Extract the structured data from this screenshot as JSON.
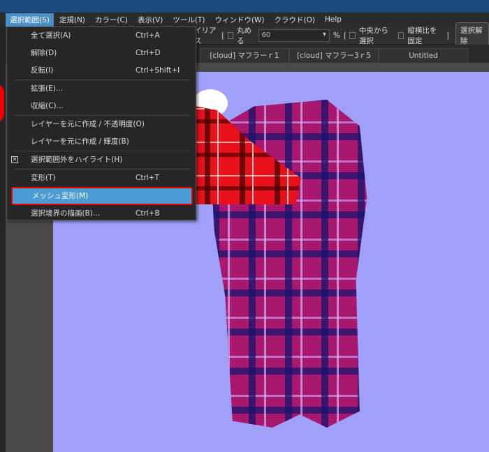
{
  "menubar": [
    "選択範囲(S)",
    "定規(N)",
    "カラー(C)",
    "表示(V)",
    "ツール(T)",
    "ウィンドウ(W)",
    "クラウド(O)",
    "Help"
  ],
  "toolbar": {
    "antialias": "イリアス",
    "round_label": "丸める",
    "round_value": "60",
    "percent": "%",
    "from_center": "中央から選択",
    "fix_ratio": "縦横比を固定",
    "deselect": "選択解除"
  },
  "tabs": [
    "[cloud] マフラーｒ1",
    "[cloud] マフラー3ｒ5",
    "Untitled"
  ],
  "menu": {
    "items": [
      {
        "label": "全て選択(A)",
        "shortcut": "Ctrl+A"
      },
      {
        "label": "解除(D)",
        "shortcut": "Ctrl+D"
      },
      {
        "label": "反転(I)",
        "shortcut": "Ctrl+Shift+I"
      },
      {
        "label": "拡張(E)...",
        "shortcut": ""
      },
      {
        "label": "収縮(C)...",
        "shortcut": ""
      },
      {
        "label": "レイヤーを元に作成 / 不透明度(O)",
        "shortcut": ""
      },
      {
        "label": "レイヤーを元に作成 / 輝度(B)",
        "shortcut": ""
      },
      {
        "label": "選択範囲外をハイライト(H)",
        "shortcut": "",
        "checked": true
      },
      {
        "label": "変形(T)",
        "shortcut": "Ctrl+T"
      },
      {
        "label": "メッシュ変形(M)",
        "shortcut": "",
        "highlighted": true
      },
      {
        "label": "選択境界の描画(B)...",
        "shortcut": "Ctrl+B"
      }
    ]
  },
  "colors": {
    "titlebar": "#1a4a7e",
    "highlight": "#4b9bd4",
    "annotation": "#e00000",
    "canvas": "#a0a0f8"
  }
}
